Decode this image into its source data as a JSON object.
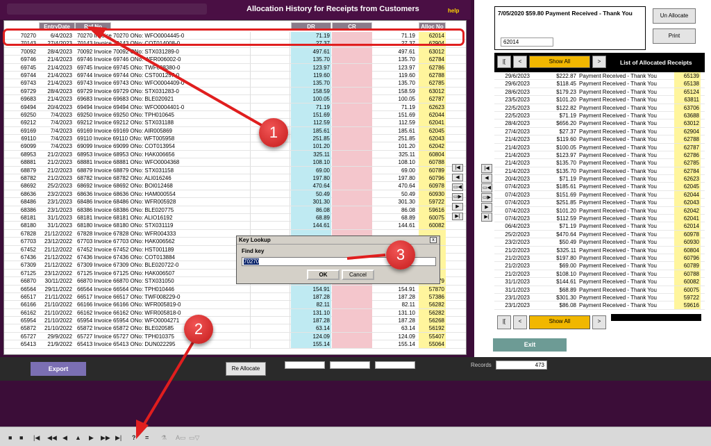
{
  "window": {
    "title": "Allocation History for Receipts from Customers",
    "help": "help"
  },
  "grid": {
    "headers": {
      "entry_date": "EntryDate",
      "ref_no": "Ref No",
      "dr": "DR",
      "cr": "CR",
      "alloc_no": "Alloc No"
    },
    "rows": [
      {
        "id": "70270",
        "date": "6/4/2023",
        "desc": "70270 Invoice 70270 ONo: WFO0004445-0",
        "dr": "71.19",
        "amt": "71.19",
        "alloc": "62014"
      },
      {
        "id": "70143",
        "date": "27/4/2023",
        "desc": "70143 Invoice 70143 ONo: COT014008-0",
        "dr": "27.37",
        "amt": "27.37",
        "alloc": "62904"
      },
      {
        "id": "70092",
        "date": "28/4/2023",
        "desc": "70092 Invoice 70092 ONo: STX031289-0",
        "dr": "497.61",
        "amt": "497.61",
        "alloc": "63012"
      },
      {
        "id": "69746",
        "date": "21/4/2023",
        "desc": "69746 Invoice 69746 ONo: WFR006002-0",
        "dr": "135.70",
        "amt": "135.70",
        "alloc": "62784"
      },
      {
        "id": "69745",
        "date": "21/4/2023",
        "desc": "69745 Invoice 69745 ONo: TWF008380-0",
        "dr": "123.97",
        "amt": "123.97",
        "alloc": "62786"
      },
      {
        "id": "69744",
        "date": "21/4/2023",
        "desc": "69744 Invoice 69744 ONo: CST001257-0",
        "dr": "119.60",
        "amt": "119.60",
        "alloc": "62788"
      },
      {
        "id": "69743",
        "date": "21/4/2023",
        "desc": "69743 Invoice 69743 ONo: WFO0004409-0",
        "dr": "135.70",
        "amt": "135.70",
        "alloc": "62785"
      },
      {
        "id": "69729",
        "date": "28/4/2023",
        "desc": "69729 Invoice 69729 ONo: STX031283-0",
        "dr": "158.59",
        "amt": "158.59",
        "alloc": "63012"
      },
      {
        "id": "69683",
        "date": "21/4/2023",
        "desc": "69683 Invoice 69683 ONo: BLE020921",
        "dr": "100.05",
        "amt": "100.05",
        "alloc": "62787"
      },
      {
        "id": "69494",
        "date": "20/4/2023",
        "desc": "69494 Invoice 69494 ONo: WFO0004401-0",
        "dr": "71.19",
        "amt": "71.19",
        "alloc": "62623"
      },
      {
        "id": "69250",
        "date": "7/4/2023",
        "desc": "69250 Invoice 69250 ONo: TPH010645",
        "dr": "151.69",
        "amt": "151.69",
        "alloc": "62044"
      },
      {
        "id": "69212",
        "date": "7/4/2023",
        "desc": "69212 Invoice 69212 ONo: STX031188",
        "dr": "112.59",
        "amt": "112.59",
        "alloc": "62041"
      },
      {
        "id": "69169",
        "date": "7/4/2023",
        "desc": "69169 Invoice 69169 ONo: AIR005869",
        "dr": "185.61",
        "amt": "185.61",
        "alloc": "62045"
      },
      {
        "id": "69110",
        "date": "7/4/2023",
        "desc": "69110 Invoice 69110 ONo: WFT005958",
        "dr": "251.85",
        "amt": "251.85",
        "alloc": "62043"
      },
      {
        "id": "69099",
        "date": "7/4/2023",
        "desc": "69099 Invoice 69099 ONo: COT013954",
        "dr": "101.20",
        "amt": "101.20",
        "alloc": "62042"
      },
      {
        "id": "68953",
        "date": "21/2/2023",
        "desc": "68953 Invoice 68953 ONo: HAK006656",
        "dr": "325.11",
        "amt": "325.11",
        "alloc": "60804"
      },
      {
        "id": "68881",
        "date": "21/2/2023",
        "desc": "68881 Invoice 68881 ONo: WFO0004368",
        "dr": "108.10",
        "amt": "108.10",
        "alloc": "60788"
      },
      {
        "id": "68879",
        "date": "21/2/2023",
        "desc": "68879 Invoice 68879 ONo: STX031158",
        "dr": "69.00",
        "amt": "69.00",
        "alloc": "60789"
      },
      {
        "id": "68782",
        "date": "21/2/2023",
        "desc": "68782 Invoice 68782 ONo: ALI016246",
        "dr": "197.80",
        "amt": "197.80",
        "alloc": "60796"
      },
      {
        "id": "68692",
        "date": "25/2/2023",
        "desc": "68692 Invoice 68692 ONo: BOI012468",
        "dr": "470.64",
        "amt": "470.64",
        "alloc": "60978"
      },
      {
        "id": "68636",
        "date": "23/2/2023",
        "desc": "68636 Invoice 68636 ONo: HAM000554",
        "dr": "50.49",
        "amt": "50.49",
        "alloc": "60930"
      },
      {
        "id": "68486",
        "date": "23/1/2023",
        "desc": "68486 Invoice 68486 ONo: WFR005928",
        "dr": "301.30",
        "amt": "301.30",
        "alloc": "59722"
      },
      {
        "id": "68386",
        "date": "23/1/2023",
        "desc": "68386 Invoice 68386 ONo: BLE020775",
        "dr": "86.08",
        "amt": "86.08",
        "alloc": "59616"
      },
      {
        "id": "68181",
        "date": "31/1/2023",
        "desc": "68181 Invoice 68181 ONo: ALIO16192",
        "dr": "68.89",
        "amt": "68.89",
        "alloc": "60075"
      },
      {
        "id": "68180",
        "date": "31/1/2023",
        "desc": "68180 Invoice 68180 ONo: STX031119",
        "dr": "144.61",
        "amt": "144.61",
        "alloc": "60082"
      },
      {
        "id": "67828",
        "date": "21/12/2022",
        "desc": "67828 Invoice 67828 ONo: WFR004333",
        "dr": "",
        "amt": "",
        "alloc": ""
      },
      {
        "id": "67703",
        "date": "23/12/2022",
        "desc": "67703 Invoice 67703 ONo: HAK006562",
        "dr": "",
        "amt": "",
        "alloc": ""
      },
      {
        "id": "67452",
        "date": "21/12/2022",
        "desc": "67452 Invoice 67452 ONo: HST001189",
        "dr": "",
        "amt": "",
        "alloc": ""
      },
      {
        "id": "67436",
        "date": "21/12/2022",
        "desc": "67436 Invoice 67436 ONo: COT013884",
        "dr": "",
        "amt": "",
        "alloc": ""
      },
      {
        "id": "67309",
        "date": "21/12/2022",
        "desc": "67309 Invoice 67309 ONo: BLE020722-0",
        "dr": "",
        "amt": "",
        "alloc": ""
      },
      {
        "id": "67125",
        "date": "23/12/2022",
        "desc": "67125 Invoice 67125 ONo: HAK006507",
        "dr": "",
        "amt": "",
        "alloc": ""
      },
      {
        "id": "66870",
        "date": "30/11/2022",
        "desc": "66870 Invoice 66870 ONo: STX031050",
        "dr": "134.30",
        "amt": "134.30",
        "alloc": "57979"
      },
      {
        "id": "66564",
        "date": "29/11/2022",
        "desc": "66564 Invoice 66564 ONo: TPH010446",
        "dr": "154.91",
        "amt": "154.91",
        "alloc": "57870"
      },
      {
        "id": "66517",
        "date": "21/11/2022",
        "desc": "66517 Invoice 66517 ONo: TWF008229-0",
        "dr": "187.28",
        "amt": "187.28",
        "alloc": "57386"
      },
      {
        "id": "66166",
        "date": "21/10/2022",
        "desc": "66166 Invoice 66166 ONo: WFR005819-0",
        "dr": "82.11",
        "amt": "82.11",
        "alloc": "56282"
      },
      {
        "id": "66162",
        "date": "21/10/2022",
        "desc": "66162 Invoice 66162 ONo: WFR005818-0",
        "dr": "131.10",
        "amt": "131.10",
        "alloc": "56282"
      },
      {
        "id": "65954",
        "date": "21/10/2022",
        "desc": "65954 Invoice 65954 ONo: WFO0004271",
        "dr": "187.28",
        "amt": "187.28",
        "alloc": "56268"
      },
      {
        "id": "65872",
        "date": "21/10/2022",
        "desc": "65872 Invoice 65872 ONo: BLE020585",
        "dr": "63.14",
        "amt": "63.14",
        "alloc": "56192"
      },
      {
        "id": "65727",
        "date": "29/9/2022",
        "desc": "65727 Invoice 65727 ONo: TPH010375",
        "dr": "124.09",
        "amt": "124.09",
        "alloc": "55407"
      },
      {
        "id": "65413",
        "date": "21/9/2022",
        "desc": "65413 Invoice 65413 ONo: DUN022295",
        "dr": "155.14",
        "amt": "155.14",
        "alloc": "55064"
      }
    ]
  },
  "footer": {
    "export": "Export",
    "reallocate": "Re Allocate",
    "records_label": "Records",
    "records_value": "473"
  },
  "payment": {
    "text": "7/05/2020 $59.80 Payment Received - Thank You",
    "ref": "62014",
    "unallocate": "Un Allocate",
    "print": "Print"
  },
  "receipts": {
    "title": "List of Allocated Receipts",
    "show_all": "Show All",
    "nav_first": "|[",
    "nav_prev": "<",
    "nav_next": ">",
    "exit": "Exit",
    "rows": [
      {
        "d": "29/6/2023",
        "a": "$222.87",
        "t": "Payment Received - Thank You",
        "i": "65139"
      },
      {
        "d": "29/6/2023",
        "a": "$118.45",
        "t": "Payment Received - Thank You",
        "i": "65138"
      },
      {
        "d": "28/6/2023",
        "a": "$179.23",
        "t": "Payment Received - Thank You",
        "i": "65124"
      },
      {
        "d": "23/5/2023",
        "a": "$101.20",
        "t": "Payment Received - Thank You",
        "i": "63811"
      },
      {
        "d": "22/5/2023",
        "a": "$122.82",
        "t": "Payment Received - Thank You",
        "i": "63706"
      },
      {
        "d": "22/5/2023",
        "a": "$71.19",
        "t": "Payment Received - Thank You",
        "i": "63688"
      },
      {
        "d": "28/4/2023",
        "a": "$656.20",
        "t": "Payment Received - Thank You",
        "i": "63012"
      },
      {
        "d": "27/4/2023",
        "a": "$27.37",
        "t": "Payment Received - Thank You",
        "i": "62904"
      },
      {
        "d": "21/4/2023",
        "a": "$119.60",
        "t": "Payment Received - Thank You",
        "i": "62788"
      },
      {
        "d": "21/4/2023",
        "a": "$100.05",
        "t": "Payment Received - Thank You",
        "i": "62787"
      },
      {
        "d": "21/4/2023",
        "a": "$123.97",
        "t": "Payment Received - Thank You",
        "i": "62786"
      },
      {
        "d": "21/4/2023",
        "a": "$135.70",
        "t": "Payment Received - Thank You",
        "i": "62785"
      },
      {
        "d": "21/4/2023",
        "a": "$135.70",
        "t": "Payment Received - Thank You",
        "i": "62784"
      },
      {
        "d": "20/4/2023",
        "a": "$71.19",
        "t": "Payment Received - Thank You",
        "i": "62623"
      },
      {
        "d": "07/4/2023",
        "a": "$185.61",
        "t": "Payment Received - Thank You",
        "i": "62045"
      },
      {
        "d": "07/4/2023",
        "a": "$151.69",
        "t": "Payment Received - Thank You",
        "i": "62044"
      },
      {
        "d": "07/4/2023",
        "a": "$251.85",
        "t": "Payment Received - Thank You",
        "i": "62043"
      },
      {
        "d": "07/4/2023",
        "a": "$101.20",
        "t": "Payment Received - Thank You",
        "i": "62042"
      },
      {
        "d": "07/4/2023",
        "a": "$112.59",
        "t": "Payment Received - Thank You",
        "i": "62041"
      },
      {
        "d": "06/4/2023",
        "a": "$71.19",
        "t": "Payment Received - Thank You",
        "i": "62014"
      },
      {
        "d": "25/2/2023",
        "a": "$470.64",
        "t": "Payment Received - Thank You",
        "i": "60978"
      },
      {
        "d": "23/2/2023",
        "a": "$50.49",
        "t": "Payment Received - Thank You",
        "i": "60930"
      },
      {
        "d": "21/2/2023",
        "a": "$325.11",
        "t": "Payment Received - Thank You",
        "i": "60804"
      },
      {
        "d": "21/2/2023",
        "a": "$197.80",
        "t": "Payment Received - Thank You",
        "i": "60796"
      },
      {
        "d": "21/2/2023",
        "a": "$69.00",
        "t": "Payment Received - Thank You",
        "i": "60789"
      },
      {
        "d": "21/2/2023",
        "a": "$108.10",
        "t": "Payment Received - Thank You",
        "i": "60788"
      },
      {
        "d": "31/1/2023",
        "a": "$144.61",
        "t": "Payment Received - Thank You",
        "i": "60082"
      },
      {
        "d": "31/1/2023",
        "a": "$68.89",
        "t": "Payment Received - Thank You",
        "i": "60075"
      },
      {
        "d": "23/1/2023",
        "a": "$301.30",
        "t": "Payment Received - Thank You",
        "i": "59722"
      },
      {
        "d": "23/1/2023",
        "a": "$86.08",
        "t": "Payment Received - Thank You",
        "i": "59616"
      }
    ]
  },
  "dialog": {
    "title": "Key Lookup",
    "label": "Find key",
    "value": "70270",
    "ok": "OK",
    "cancel": "Cancel",
    "close": "x"
  },
  "annotations": {
    "one": "1",
    "two": "2",
    "three": "3",
    "color": "#e01e1e"
  },
  "statusbar": {
    "icons": [
      "stop",
      "first",
      "rewind",
      "prev",
      "up",
      "next",
      "fast-forward",
      "last",
      "find",
      "equals"
    ]
  }
}
